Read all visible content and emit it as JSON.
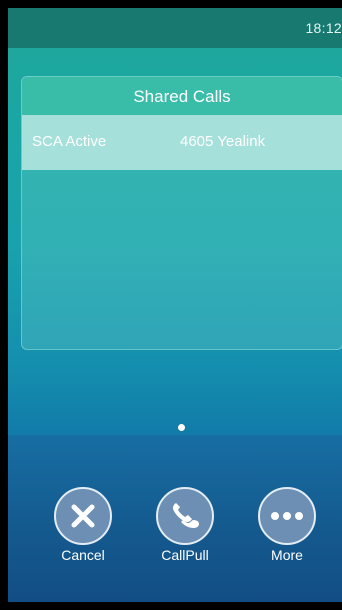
{
  "status_bar": {
    "time": "18:12"
  },
  "panel": {
    "title": "Shared Calls",
    "rows": [
      {
        "status": "SCA Active",
        "line": "4605 Yealink"
      }
    ]
  },
  "pager": {
    "current_page": 1
  },
  "softkeys": [
    {
      "label": "Cancel",
      "icon": "close-icon"
    },
    {
      "label": "CallPull",
      "icon": "phone-hand-icon"
    },
    {
      "label": "More",
      "icon": "more-dots-icon"
    }
  ],
  "colors": {
    "status_bar": "#17796f",
    "panel_header": "#39bca8",
    "selected_row": "#a6e0da",
    "softkey_bar": "#145a8f",
    "softkey_circle": "#6d8fb4"
  }
}
